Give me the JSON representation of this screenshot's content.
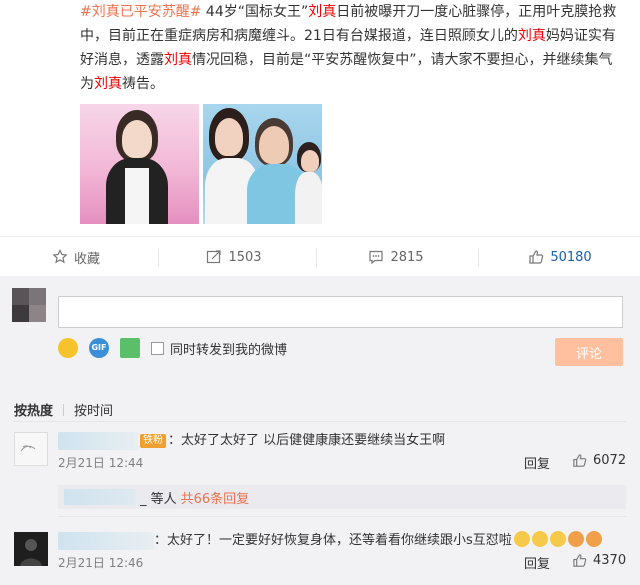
{
  "post": {
    "hashtag": "#刘真已平安苏醒#",
    "segments": [
      {
        "t": " 44岁“国标女王”",
        "hl": false
      },
      {
        "t": "刘真",
        "hl": true
      },
      {
        "t": "日前被曝开刀一度心脏骤停，正用叶克膜抢救中，目前正在重症病房和病魔缠斗。21日有台媒报道，连日照顾女儿的",
        "hl": false
      },
      {
        "t": "刘真",
        "hl": true
      },
      {
        "t": "妈妈证实有好消息，透露",
        "hl": false
      },
      {
        "t": "刘真",
        "hl": true
      },
      {
        "t": "情况回稳，目前是“平安苏醒恢复中”，请大家不要担心，并继续集气为",
        "hl": false
      },
      {
        "t": "刘真",
        "hl": true
      },
      {
        "t": "祷告。",
        "hl": false
      }
    ]
  },
  "actions": {
    "favorite": "收藏",
    "repost": "1503",
    "comment": "2815",
    "like": "50180"
  },
  "composer": {
    "repost_label": "同时转发到我的微博",
    "submit": "评论",
    "gif": "GIF"
  },
  "sort": {
    "by_hot": "按热度",
    "by_time": "按时间"
  },
  "comments": [
    {
      "badge": "铁粉",
      "text": "太好了太好了 以后健健康康还要继续当女王啊",
      "date": "2月21日 12:44",
      "reply": "回复",
      "likes": "6072",
      "subreply_suffix": "_ 等人",
      "subreply_count": "共66条回复"
    },
    {
      "text": "太好了！一定要好好恢复身体，还等着看你继续跟小s互怼啦",
      "date": "2月21日 12:46",
      "reply": "回复",
      "likes": "4370"
    }
  ],
  "colors": {
    "tag": "#eb7350",
    "highlight": "#e00000",
    "like_count": "#1a5fa8",
    "submit_bg": "#ffc09f"
  }
}
